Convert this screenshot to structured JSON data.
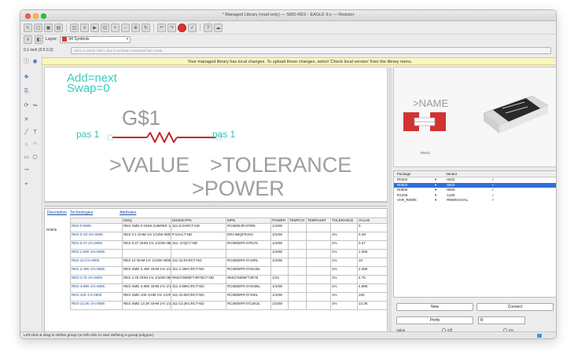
{
  "window": {
    "title": "* Managed Library (read-only) — SMD-RES - EAGLE 9.x — Resistor"
  },
  "toolbar": {
    "layer_label": "Layer:",
    "layer_value": "94 Symbols"
  },
  "command_bar": {
    "coordinate": "0.1 inch (0.5 0.2)",
    "placeholder": "Click or press Ctrl+L key to activate command line mode"
  },
  "notice": {
    "text": "Your managed library has local changes. To upload those changes, select 'Check local version' from the library menu."
  },
  "symbol": {
    "add_text": "Add=next",
    "swap_text": "Swap=0",
    "gate_name": "G$1",
    "pin_left": "pas 1",
    "pin_right": "pas 1",
    "value_label": ">VALUE",
    "tolerance_label": ">TOLERANCE",
    "power_label": ">POWER",
    "colors": {
      "attribute_text": "#3ccabd",
      "label_text": "#9e9e9e",
      "resistor": "#c62828"
    }
  },
  "preview": {
    "name_label": ">NAME",
    "caption": "R0402"
  },
  "package_table": {
    "headers": [
      "Package",
      "",
      "Variant",
      ""
    ],
    "rows": [
      {
        "package": "R0402",
        "variant": "-0402",
        "check": "✓"
      },
      {
        "package": "R0603",
        "variant": "-0603",
        "check": "✓",
        "selected": true
      },
      {
        "package": "R0805",
        "variant": "-0805",
        "check": "✓"
      },
      {
        "package": "R1206",
        "variant": "-1206",
        "check": "✓"
      },
      {
        "package": "VAR_R0805",
        "variant": "-R0805-KOAL",
        "check": "✓"
      }
    ]
  },
  "actions": {
    "new_label": "New",
    "connect_label": "Connect",
    "prefix_label": "Prefix",
    "prefix_value": "R",
    "value_label": "Value",
    "off_label": "Off",
    "on_label": "On"
  },
  "parts": {
    "tabs": [
      "Description",
      "Technologies",
      "Attributes"
    ],
    "side_label": "R0805",
    "headers": [
      "",
      "MOQ",
      "DIGIKEYPN",
      "MPN",
      "POWER",
      "TEMPCO",
      "TEMPLIMIT",
      "TOLERANCE",
      "VALUE"
    ],
    "rows": [
      [
        "RES-0-0805",
        "RES SMD 0 OHM JUMPER 1/10W 0805",
        "311-0.0ARCT-ND",
        "RC0805JR-070RL",
        "1/10W",
        "",
        "",
        "",
        "0"
      ],
      [
        "RES-0.1R-1%-0805",
        "RES 0.1 OHM 1% 1/10W 0805",
        "P.10ACT-ND",
        "ERJ-6BQFR10V",
        "1/10W",
        "",
        "",
        "1%",
        "0.1R"
      ],
      [
        "RES-0.47-1%-0805",
        "RES 0.47 OHM 1% 1/10W 0805",
        "311-.47QCT-ND",
        "RC0805FR-07R47L",
        "1/10W",
        "",
        "",
        "1%",
        "0.47"
      ],
      [
        "RES-1.00K-1%-0805",
        "",
        "",
        "",
        "1/10W",
        "",
        "",
        "1%",
        "1.00K"
      ],
      [
        "RES-10-1%-0805",
        "RES 10 OHM 1% 1/10W 0805",
        "311-10.0CRCT-ND",
        "RC0805FR-0710RL",
        "1/10W",
        "",
        "",
        "1%",
        "10"
      ],
      [
        "RES-2.49K-1%-0805",
        "RES SMD 2.49K OHM 1% 1/10W 0805",
        "311-2.49KCRCT-ND",
        "RC0805FR-072K49L",
        "",
        "",
        "",
        "1%",
        "2.49K"
      ],
      [
        "RES-4.75-1%-0805",
        "RES 4.75 OHM 1% 1/10W 0805",
        "RMCF0805FT4R75CT-ND",
        "RMCF0805FT4R75",
        "1/10",
        "",
        "",
        "1%",
        "4.75"
      ],
      [
        "RES-4.99K-1%-0805",
        "RES SMD 4.99K OHM 1% 1/10W 0805",
        "311-4.99KCRCT-ND",
        "RC0805FR-074K99L",
        "1/10W",
        "",
        "",
        "1%",
        "4.99K"
      ],
      [
        "RES-10K-1%-0805",
        "RES SMD 10K OHM 1% 1/10W 0805",
        "311-10.0KCRCT-ND",
        "RC0805FR-0710KL",
        "1/10W",
        "",
        "",
        "1%",
        "10K"
      ],
      [
        "RES-13.3K-1%-0805",
        "RES SMD 13.3K OHM 1% 1/10W 0805",
        "311-13.3KCRCT-ND",
        "RC0805FR-0713K3L",
        "1/10W",
        "",
        "",
        "1%",
        "13.3K"
      ]
    ]
  },
  "status": {
    "text": "Left-click & drag to define group (or left-click to start defining a group polygon)"
  }
}
